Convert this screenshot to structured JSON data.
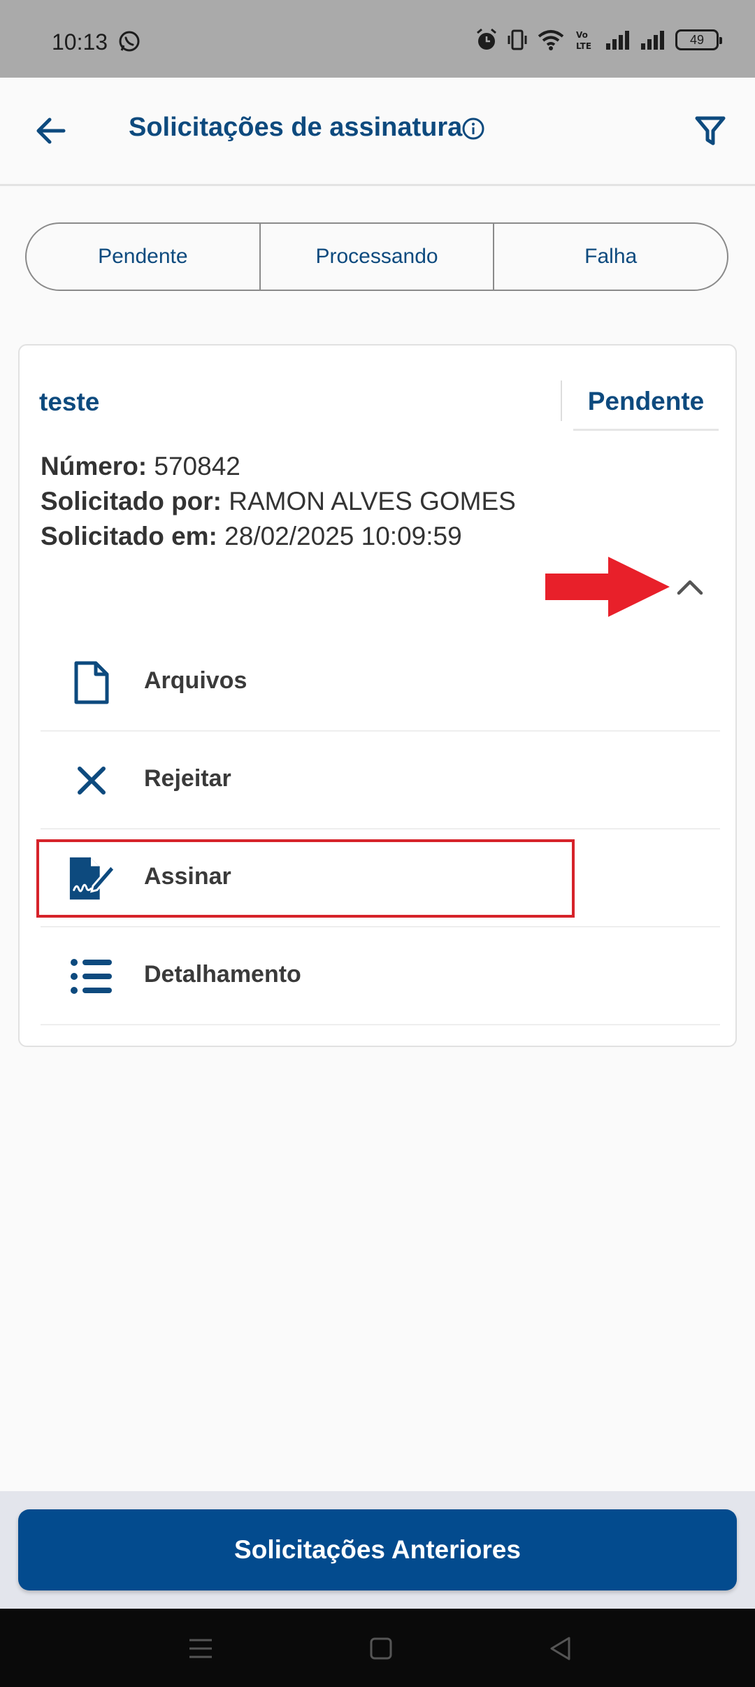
{
  "status_bar": {
    "time": "10:13",
    "battery": "49",
    "icons": [
      "whatsapp-icon",
      "alarm-icon",
      "vibrate-icon",
      "wifi-icon",
      "volte-icon",
      "signal-icon",
      "signal-icon",
      "battery-icon"
    ]
  },
  "app_bar": {
    "title": "Solicitações de assinatura",
    "back_icon": "arrow-left-icon",
    "info_icon": "info-icon",
    "filter_icon": "filter-icon"
  },
  "tabs": [
    {
      "label": "Pendente"
    },
    {
      "label": "Processando"
    },
    {
      "label": "Falha"
    }
  ],
  "card": {
    "title": "teste",
    "status": "Pendente",
    "fields": [
      {
        "label": "Número:",
        "value": "570842"
      },
      {
        "label": "Solicitado por:",
        "value": "RAMON ALVES GOMES"
      },
      {
        "label": "Solicitado em:",
        "value": "28/02/2025 10:09:59"
      }
    ],
    "actions": [
      {
        "label": "Arquivos",
        "icon": "file-icon"
      },
      {
        "label": "Rejeitar",
        "icon": "close-icon"
      },
      {
        "label": "Assinar",
        "icon": "signature-icon"
      },
      {
        "label": "Detalhamento",
        "icon": "list-icon"
      }
    ]
  },
  "footer": {
    "button_label": "Solicitações Anteriores"
  },
  "colors": {
    "primary": "#0d4a7e",
    "button": "#034b8e",
    "highlight": "#d6232a",
    "arrow": "#e8202a"
  }
}
